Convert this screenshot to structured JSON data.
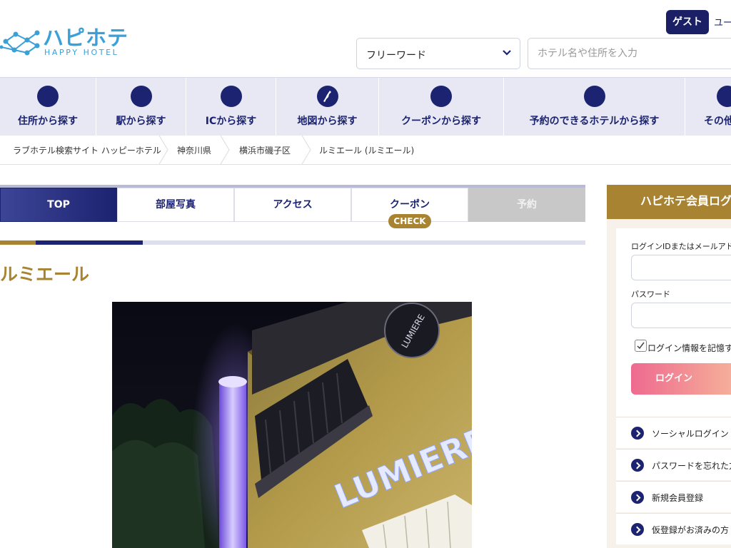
{
  "header": {
    "logo_jp": "ハピホテ",
    "logo_en": "HAPPY HOTEL",
    "guest_label": "ゲスト",
    "user_link": "ユー",
    "search_type": "フリーワード",
    "search_placeholder": "ホテル名や住所を入力"
  },
  "nav": {
    "items": [
      {
        "label": "住所から探す",
        "icon": "location-icon"
      },
      {
        "label": "駅から探す",
        "icon": "train-icon"
      },
      {
        "label": "ICから探す",
        "icon": "highway-icon"
      },
      {
        "label": "地図から探す",
        "icon": "map-icon"
      },
      {
        "label": "クーポンから探す",
        "icon": "coupon-icon"
      },
      {
        "label": "予約のできるホテルから探す",
        "icon": "calendar-icon"
      },
      {
        "label": "その他",
        "icon": "more-icon"
      }
    ]
  },
  "breadcrumb": [
    "ラブホテル検索サイト ハッピーホテル",
    "神奈川県",
    "横浜市磯子区",
    "ルミエール (ルミエール)"
  ],
  "tabs": [
    {
      "label": "TOP",
      "state": "active"
    },
    {
      "label": "部屋写真",
      "state": "normal"
    },
    {
      "label": "アクセス",
      "state": "normal"
    },
    {
      "label": "クーポン",
      "state": "normal"
    },
    {
      "label": "予約",
      "state": "disabled"
    }
  ],
  "coupon_badge": "CHECK",
  "hotel": {
    "name": "ルミエール",
    "sign_text": "LUMIERE",
    "sign_text_small": "LUMIERE"
  },
  "login": {
    "title": "ハピホテ会員ログ",
    "id_label": "ログインIDまたはメールアドレ",
    "password_label": "パスワード",
    "remember_label": "ログイン情報を記憶す",
    "login_button": "ログイン",
    "links": [
      "ソーシャルログイン",
      "パスワードを忘れた方",
      "新規会員登録",
      "仮登録がお済みの方"
    ]
  },
  "colors": {
    "navy": "#1c2370",
    "gold": "#a88432",
    "brand_blue": "#3aa0d8"
  }
}
